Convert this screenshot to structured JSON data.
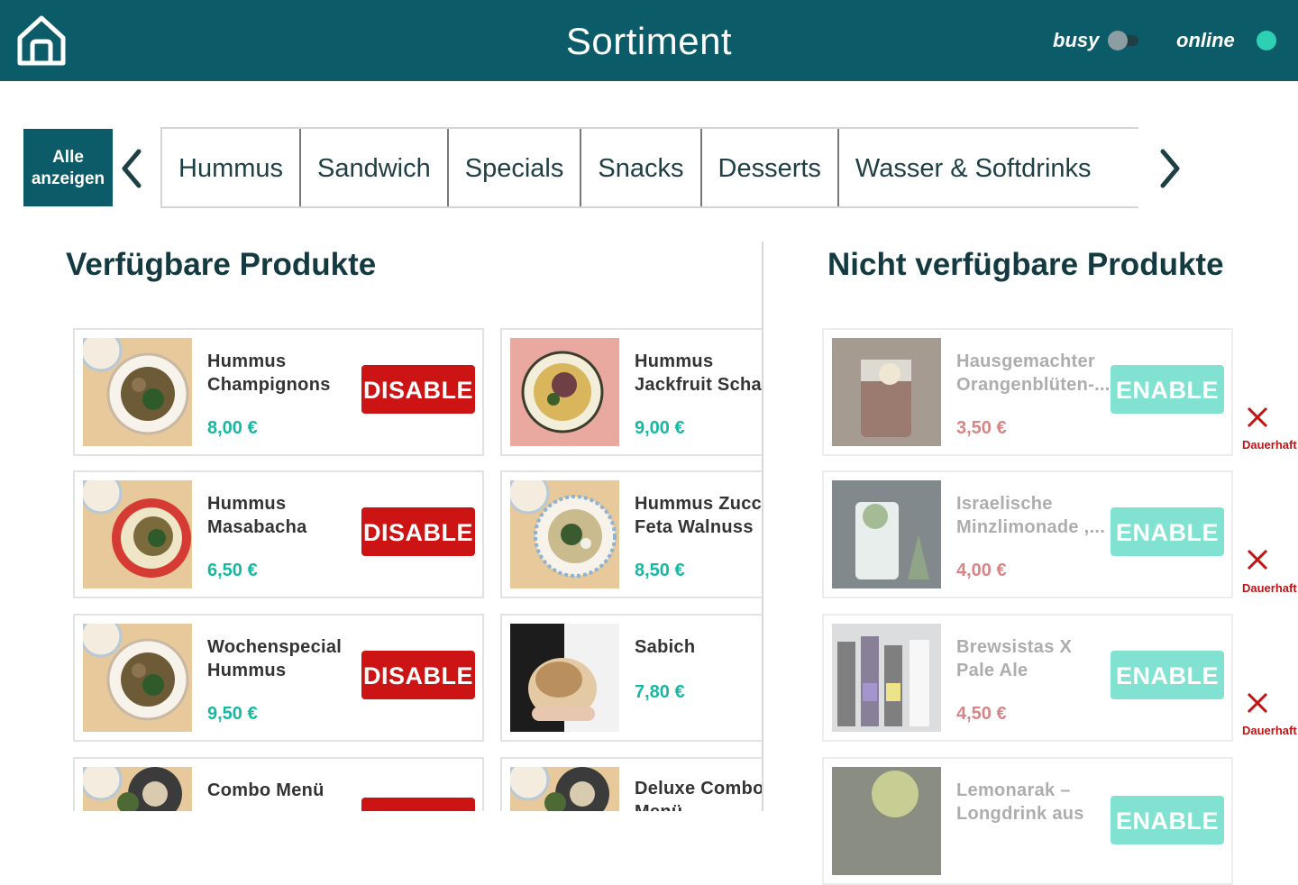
{
  "header": {
    "title": "Sortiment",
    "busy_label": "busy",
    "online_label": "online",
    "accent": "#0b5c68"
  },
  "categories": {
    "all_label_line1": "Alle",
    "all_label_line2": "anzeigen",
    "tabs": [
      "Hummus",
      "Sandwich",
      "Specials",
      "Snacks",
      "Desserts",
      "Wasser & Softdrinks"
    ]
  },
  "available": {
    "title": "Verfügbare Produkte",
    "action_label": "DISABLE",
    "products": [
      {
        "name_1": "Hummus",
        "name_2": "Champignons",
        "price": "8,00 €"
      },
      {
        "name_1": "Hummus",
        "name_2": "Jackfruit Schawarma",
        "price": "9,00 €"
      },
      {
        "name_1": "Hummus",
        "name_2": "Masabacha",
        "price": "6,50 €"
      },
      {
        "name_1": "Hummus Zucchini",
        "name_2": "Feta Walnuss",
        "price": "8,50 €"
      },
      {
        "name_1": "Wochenspecial",
        "name_2": "Hummus",
        "price": "9,50 €"
      },
      {
        "name_1": "Sabich",
        "name_2": "",
        "price": "7,80 €"
      },
      {
        "name_1": "Combo Menü",
        "name_2": "",
        "price": ""
      },
      {
        "name_1": "Deluxe Combo",
        "name_2": "Menü",
        "price": ""
      }
    ]
  },
  "unavailable": {
    "title": "Nicht verfügbare Produkte",
    "action_label": "ENABLE",
    "permanent_label": "Dauerhaft",
    "products": [
      {
        "name_1": "Hausgemachter",
        "name_2": "Orangenblüten-...",
        "price": "3,50 €"
      },
      {
        "name_1": "Israelische",
        "name_2": "Minzlimonade ,...",
        "price": "4,00 €"
      },
      {
        "name_1": "Brewsistas X",
        "name_2": "Pale Ale",
        "price": "4,50 €"
      },
      {
        "name_1": "Lemonarak –",
        "name_2": "Longdrink aus",
        "price": ""
      }
    ]
  }
}
